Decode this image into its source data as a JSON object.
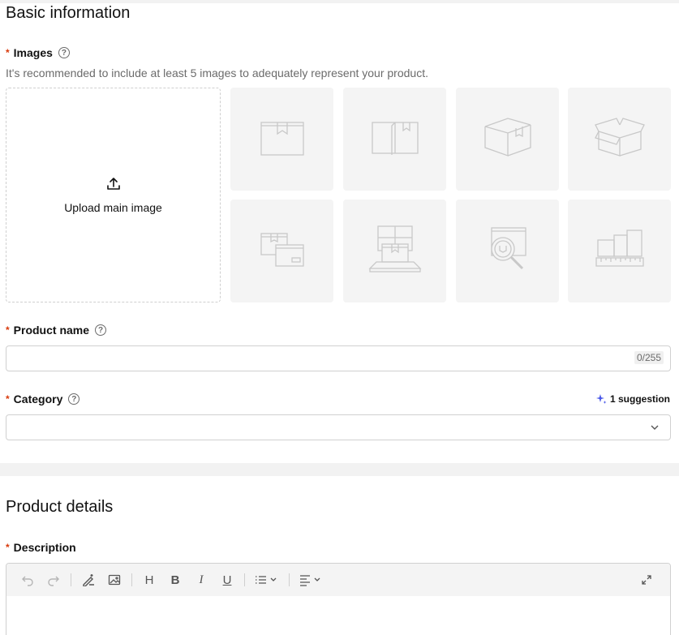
{
  "basic": {
    "title": "Basic information",
    "images_label": "Images",
    "images_hint": "It's recommended to include at least 5 images to adequately represent your product.",
    "upload_label": "Upload main image",
    "thumbnails": [
      "box-front-icon",
      "box-open-front-icon",
      "box-angle-icon",
      "box-open-top-icon",
      "box-with-label-icon",
      "box-on-scale-icon",
      "box-magnify-icon",
      "box-measure-icon"
    ]
  },
  "product_name": {
    "label": "Product name",
    "value": "",
    "counter": "0/255"
  },
  "category": {
    "label": "Category",
    "suggestion": "1 suggestion",
    "value": ""
  },
  "details": {
    "title": "Product details",
    "description_label": "Description",
    "toolbar": {
      "heading": "H",
      "bold": "B",
      "italic": "I",
      "underline": "U"
    }
  },
  "colors": {
    "required": "#d8390b",
    "accent": "#4a58e8"
  }
}
